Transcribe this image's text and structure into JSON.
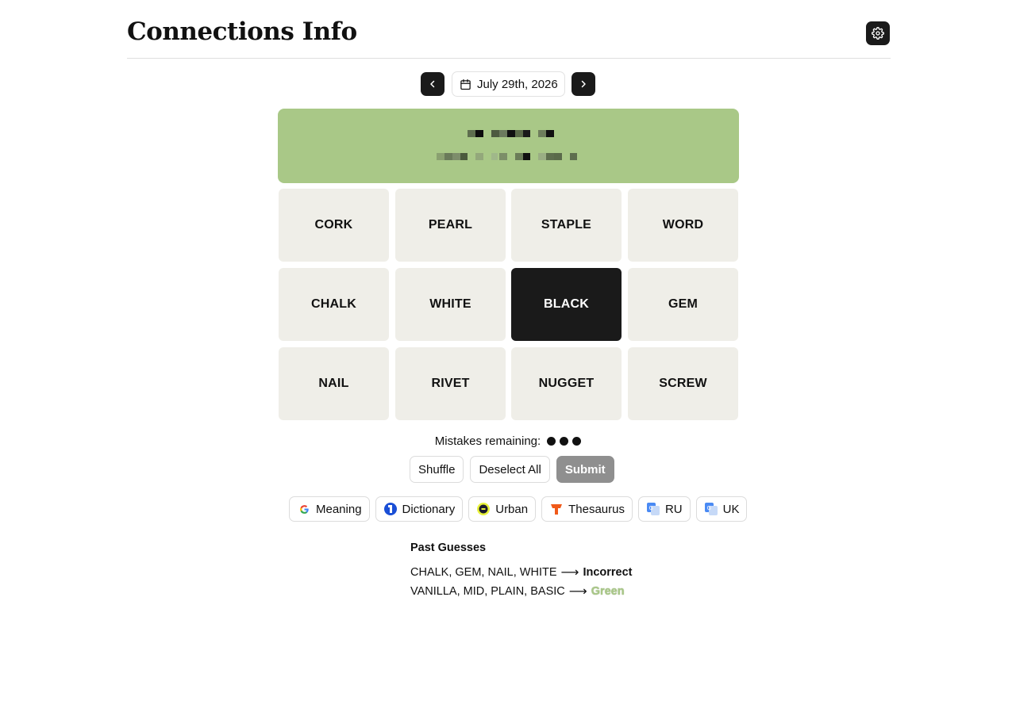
{
  "header": {
    "title": "Connections Info",
    "settings_icon": "gear-icon"
  },
  "date_nav": {
    "prev_icon": "chevron-left-icon",
    "date": "July 29th, 2026",
    "calendar_icon": "calendar-icon",
    "next_icon": "chevron-right-icon"
  },
  "solved_group": {
    "color": "#a9c887",
    "category_obscured": true
  },
  "tiles": [
    "CORK",
    "PEARL",
    "STAPLE",
    "WORD",
    "CHALK",
    "WHITE",
    "BLACK",
    "GEM",
    "NAIL",
    "RIVET",
    "NUGGET",
    "SCREW"
  ],
  "selected_tile": "BLACK",
  "mistakes": {
    "label": "Mistakes remaining:",
    "remaining": 3
  },
  "actions": {
    "shuffle": "Shuffle",
    "deselect": "Deselect All",
    "submit": "Submit"
  },
  "links": [
    {
      "label": "Meaning",
      "icon": "google-icon"
    },
    {
      "label": "Dictionary",
      "icon": "dictionary-icon"
    },
    {
      "label": "Urban",
      "icon": "urban-icon"
    },
    {
      "label": "Thesaurus",
      "icon": "thesaurus-icon"
    },
    {
      "label": "RU",
      "icon": "translate-icon"
    },
    {
      "label": "UK",
      "icon": "translate-icon"
    }
  ],
  "past_guesses": {
    "title": "Past Guesses",
    "rows": [
      {
        "words": "CHALK, GEM, NAIL, WHITE",
        "arrow": "⟶",
        "result": "Incorrect"
      },
      {
        "words": "VANILLA, MID, PLAIN, BASIC",
        "arrow": "⟶",
        "result": "Green"
      }
    ]
  },
  "colors": {
    "accent_dark": "#1a1a1a",
    "tile_bg": "#efeee8",
    "green_group": "#a9c887",
    "submit_disabled": "#8f8f8f"
  }
}
